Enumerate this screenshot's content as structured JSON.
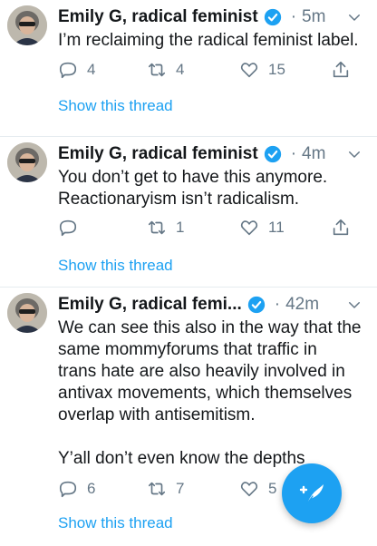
{
  "tweets": [
    {
      "author": "Emily G, radical feminist",
      "time": "5m",
      "text": "I’m reclaiming the radical feminist label.",
      "replies": "4",
      "retweets": "4",
      "likes": "15",
      "thread_label": "Show this thread"
    },
    {
      "author": "Emily G, radical feminist",
      "time": "4m",
      "text": "You don’t get to have this anymore.\nReactionaryism isn’t radicalism.",
      "replies": "",
      "retweets": "1",
      "likes": "11",
      "thread_label": "Show this thread"
    },
    {
      "author": "Emily G, radical femi...",
      "time": "42m",
      "text": "We can see this also in the way that the\nsame mommyforums that traffic in\ntrans hate are also heavily involved in\nantivax movements, which themselves\noverlap with antisemitism.\n\nY’all don’t even know the depths",
      "replies": "6",
      "retweets": "7",
      "likes": "5",
      "thread_label": "Show this thread"
    }
  ],
  "separator": "·",
  "colors": {
    "accent": "#1da1f2",
    "muted": "#657786",
    "text": "#14171a"
  },
  "icons": [
    "reply-icon",
    "retweet-icon",
    "like-icon",
    "share-icon",
    "verified-badge-icon",
    "chevron-down-icon",
    "compose-tweet-icon"
  ]
}
